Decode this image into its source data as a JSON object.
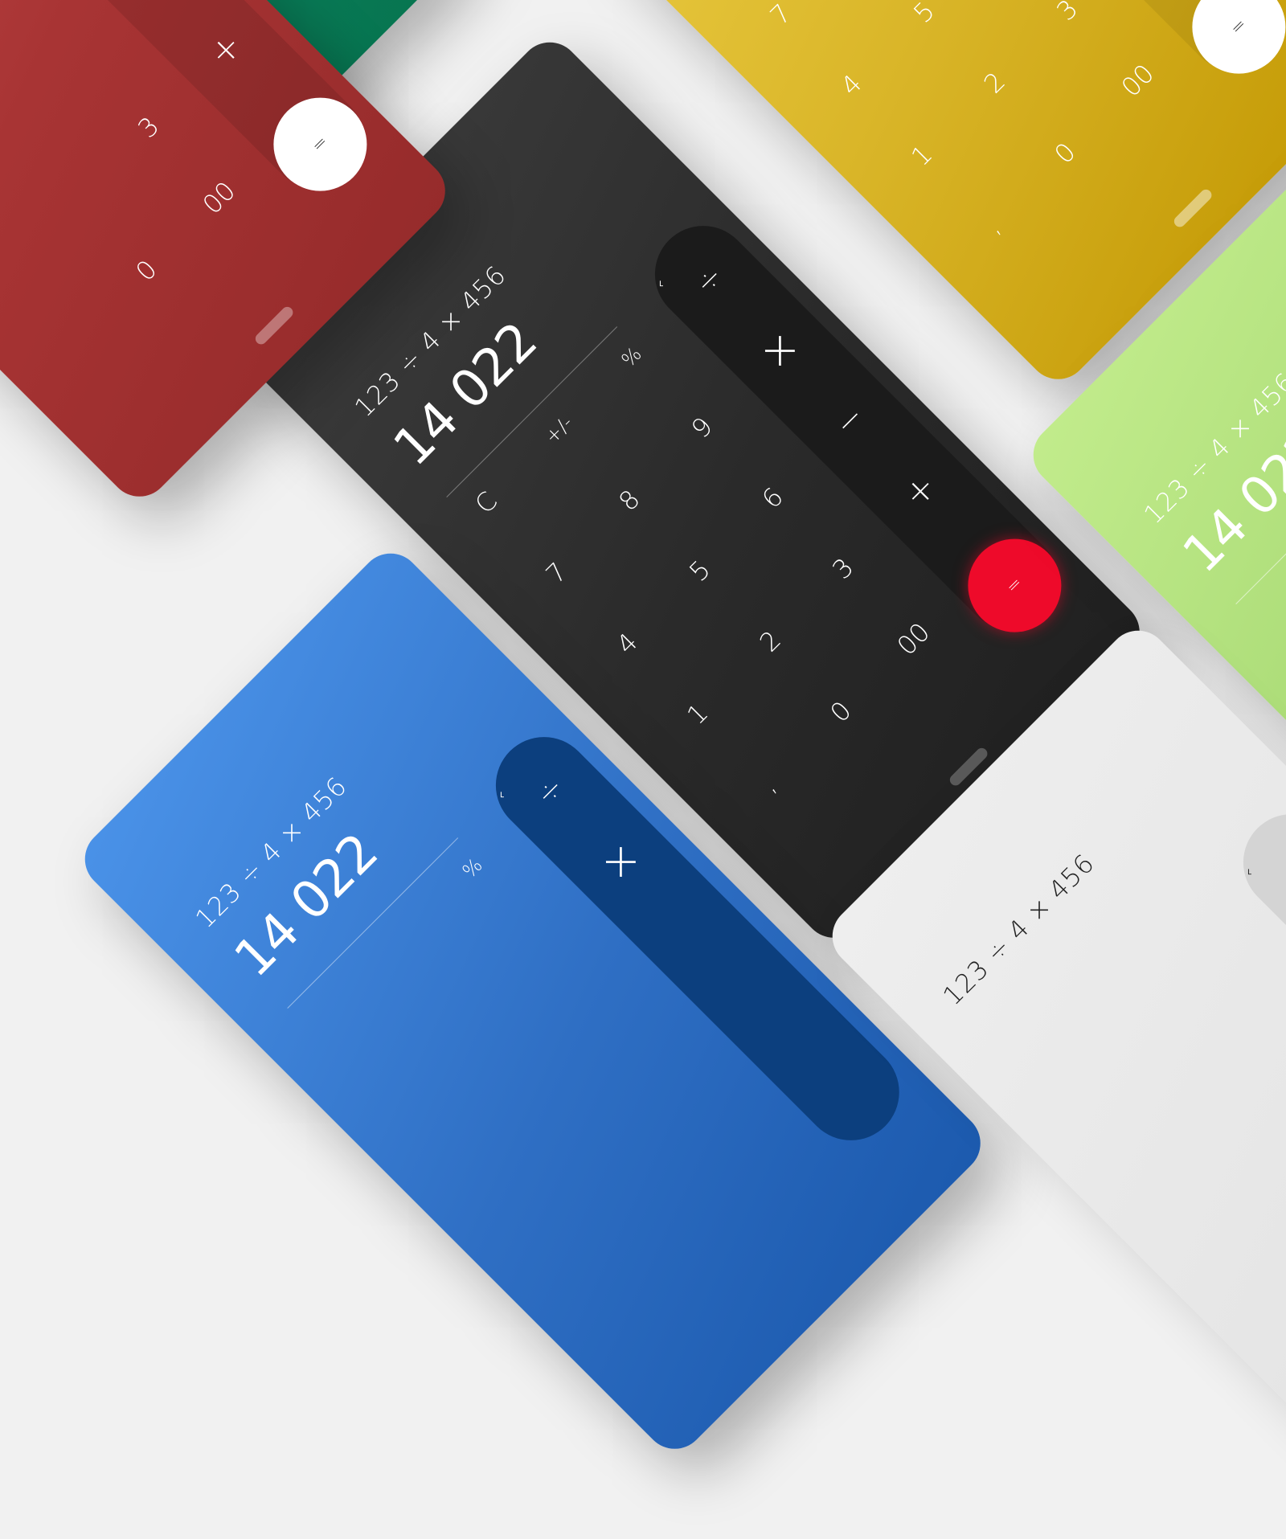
{
  "calculator": {
    "expression": "123 ÷ 4 × 456",
    "result": "14 022",
    "keys": {
      "clear": "C",
      "sign": "+/-",
      "percent": "%",
      "seven": "7",
      "eight": "8",
      "nine": "9",
      "four": "4",
      "five": "5",
      "six": "6",
      "one": "1",
      "two": "2",
      "three": "3",
      "zero": "0",
      "double_zero": "00",
      "decimal": ",",
      "divide": "÷",
      "multiply": "×",
      "minus": "−",
      "plus": "+",
      "equals": "=",
      "backspace": "⌐"
    }
  },
  "themes": {
    "dark": "#2e2e2e",
    "red_equals": "#ee0a2a",
    "green": "#0a8461",
    "yellow": "#d9b528",
    "red": "#a83434",
    "blue": "#2f6fc4",
    "lime": "#a3d670",
    "light": "#e6e6e6"
  }
}
